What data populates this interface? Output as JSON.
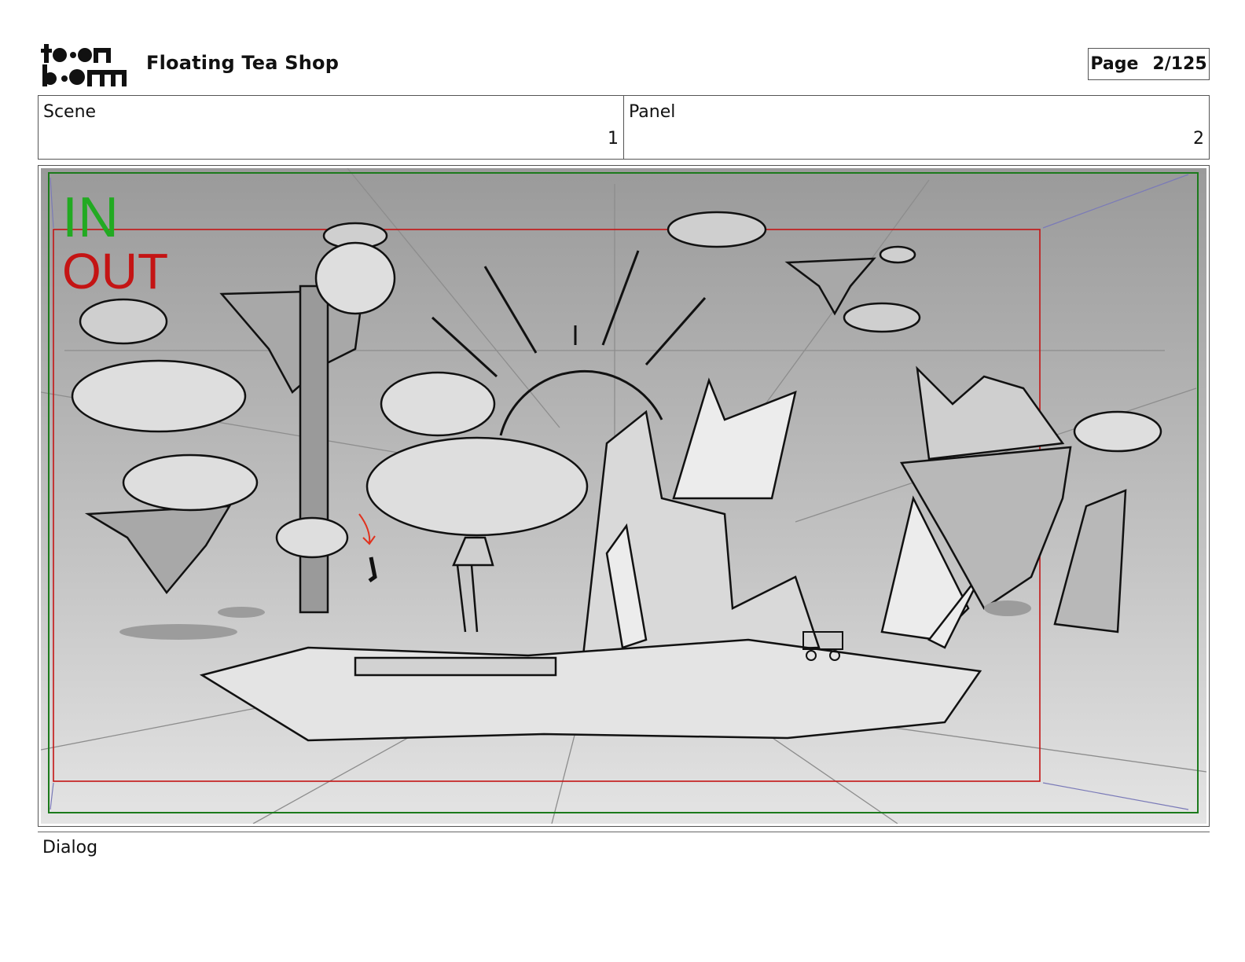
{
  "header": {
    "logo_text": "toon boom",
    "project_title": "Floating Tea Shop",
    "page_label": "Page",
    "page_value": "2/125"
  },
  "info": {
    "scene_label": "Scene",
    "scene_value": "1",
    "panel_label": "Panel",
    "panel_value": "2"
  },
  "panel": {
    "in_label": "IN",
    "out_label": "OUT",
    "in_color": "#22aa22",
    "out_color": "#c41414"
  },
  "footer": {
    "dialog_label": "Dialog"
  }
}
